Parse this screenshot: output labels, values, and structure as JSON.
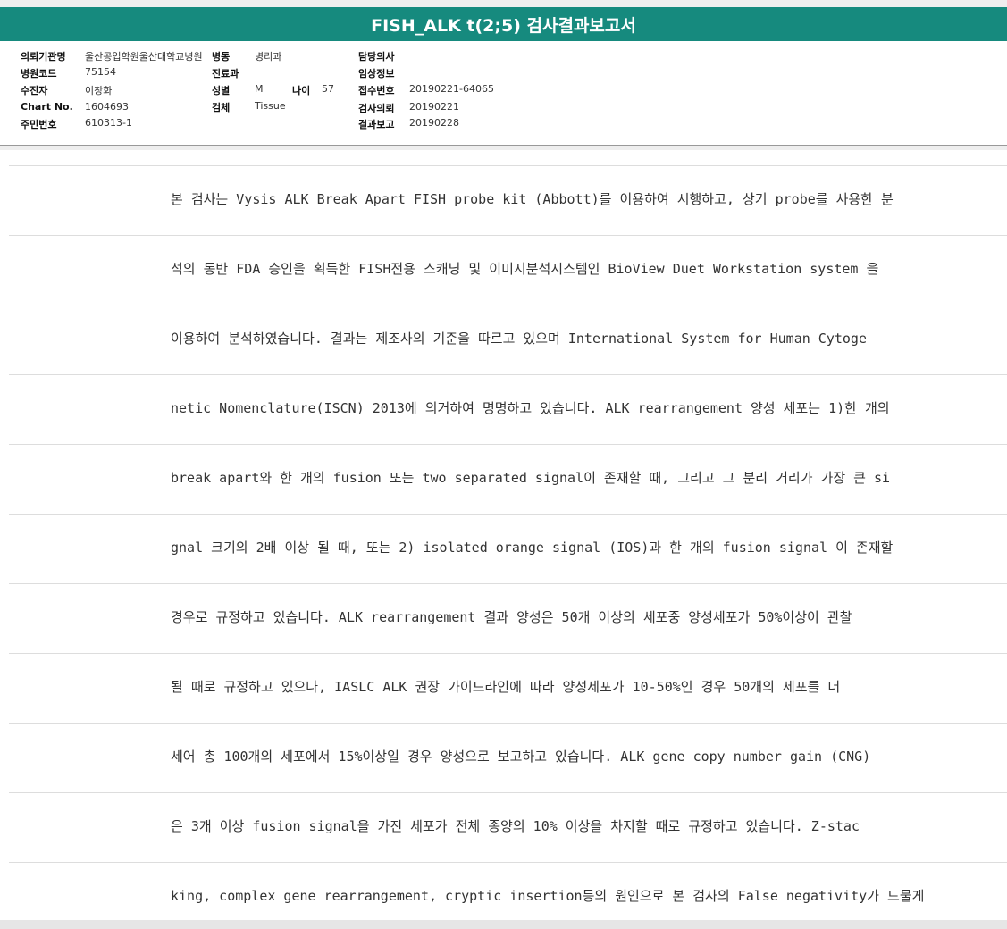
{
  "report": {
    "title": "FISH_ALK t(2;5) 검사결과보고서"
  },
  "header": {
    "institution_label": "의뢰기관명",
    "institution_value": "울산공업학원울산대학교병원",
    "ward_label": "병동",
    "ward_value": "병리과",
    "doctor_label": "담당의사",
    "doctor_value": "",
    "hospital_code_label": "병원코드",
    "hospital_code_value": "75154",
    "department_label": "진료과",
    "department_value": "",
    "clinical_info_label": "임상정보",
    "clinical_info_value": "",
    "patient_label": "수진자",
    "patient_value": "이창화",
    "sex_label": "성별",
    "sex_value": "M",
    "age_label": "나이",
    "age_value": "57",
    "receipt_no_label": "접수번호",
    "receipt_no_value": "20190221-64065",
    "chart_no_label": "Chart No.",
    "chart_no_value": "1604693",
    "specimen_label": "검체",
    "specimen_value": "Tissue",
    "request_date_label": "검사의뢰",
    "request_date_value": "20190221",
    "id_no_label": "주민번호",
    "id_no_value": "610313-1",
    "report_date_label": "결과보고",
    "report_date_value": "20190228"
  },
  "body": {
    "lines": [
      "본 검사는 Vysis ALK Break Apart FISH probe kit (Abbott)를 이용하여 시행하고, 상기 probe를 사용한 분",
      "석의 동반 FDA 승인을 획득한 FISH전용 스캐닝 및 이미지분석시스템인 BioView Duet Workstation system 을",
      " 이용하여 분석하였습니다. 결과는 제조사의 기준을 따르고 있으며 International System for Human Cytoge",
      "netic Nomenclature(ISCN) 2013에 의거하여 명명하고 있습니다. ALK rearrangement 양성 세포는 1)한 개의",
      "break apart와 한 개의 fusion 또는 two separated signal이 존재할 때, 그리고 그 분리 거리가 가장 큰 si",
      "gnal 크기의 2배 이상 될 때, 또는 2) isolated orange signal (IOS)과 한 개의 fusion signal 이 존재할",
      "경우로 규정하고 있습니다. ALK rearrangement 결과 양성은 50개 이상의 세포중 양성세포가 50%이상이 관찰",
      "될 때로 규정하고 있으나, IASLC ALK 권장 가이드라인에 따라 양성세포가 10-50%인 경우 50개의 세포를 더",
      "세어 총 100개의 세포에서 15%이상일 경우 양성으로 보고하고 있습니다. ALK gene copy number gain (CNG)",
      "은 3개 이상 fusion signal을 가진 세포가 전체 종양의 10% 이상을 차지할 때로 규정하고 있습니다. Z-stac",
      "king, complex gene rearrangement, cryptic insertion등의 원인으로 본 검사의 False negativity가 드물게"
    ]
  },
  "colors": {
    "title_bar": "#168a7e",
    "title_text": "#ffffff"
  }
}
